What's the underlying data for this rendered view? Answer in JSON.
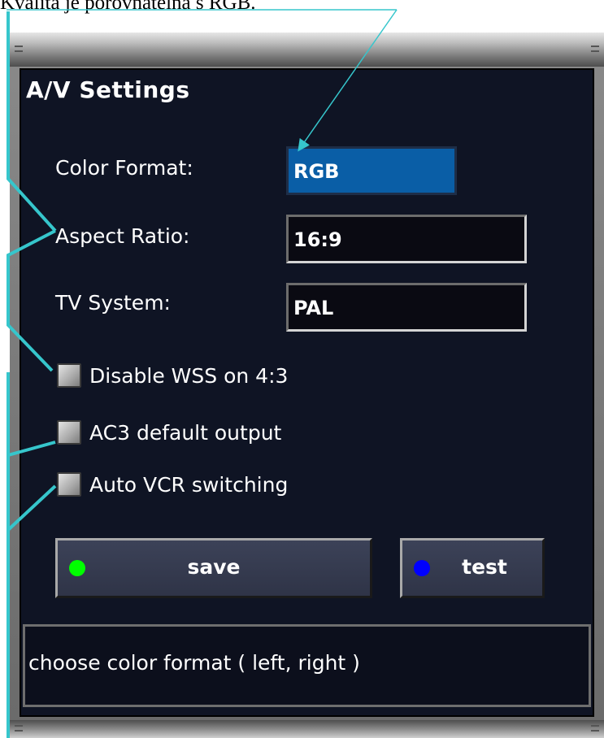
{
  "caption": "Kvalita je porovnatelná s RGB.",
  "dialog": {
    "title": "A/V Settings",
    "fields": [
      {
        "label": "Color Format:",
        "value": "RGB"
      },
      {
        "label": "Aspect Ratio:",
        "value": "16:9"
      },
      {
        "label": "TV System:",
        "value": "PAL"
      }
    ],
    "checkboxes": [
      {
        "label": "Disable WSS on 4:3",
        "checked": false
      },
      {
        "label": "AC3 default output",
        "checked": false
      },
      {
        "label": "Auto VCR switching",
        "checked": false
      }
    ],
    "buttons": {
      "save": {
        "label": "save",
        "dot_color": "#00ff00"
      },
      "test": {
        "label": "test",
        "dot_color": "#0000ff"
      }
    },
    "status_text": "choose color format ( left, right )"
  },
  "colors": {
    "annotation_line": "#36c6cc",
    "selected_field": "#0a5ea6",
    "panel_background": "#0f1424"
  }
}
